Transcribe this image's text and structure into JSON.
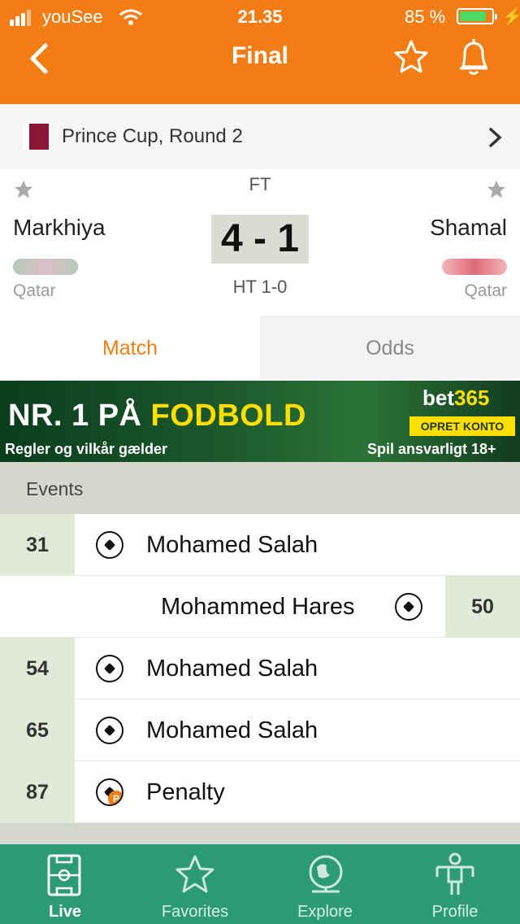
{
  "status_bar": {
    "carrier": "youSee",
    "time": "21.35",
    "battery": "85 %",
    "battery_level": 0.85
  },
  "header": {
    "title": "Final"
  },
  "competition": {
    "name": "Prince Cup, Round 2"
  },
  "match": {
    "status": "FT",
    "home_team": "Markhiya",
    "home_country": "Qatar",
    "away_team": "Shamal",
    "away_country": "Qatar",
    "score": "4 - 1",
    "halftime": "HT 1-0"
  },
  "tabs": [
    {
      "label": "Match"
    },
    {
      "label": "Odds"
    }
  ],
  "banner": {
    "headline_white": "NR. 1 PÅ ",
    "headline_yellow": "FODBOLD",
    "brand_white": "bet",
    "brand_yellow": "365",
    "cta": "OPRET KONTO",
    "terms": "Regler og vilkår gælder",
    "responsible": "Spil ansvarligt 18+"
  },
  "events": {
    "title": "Events",
    "items": [
      {
        "minute": "31",
        "player": "Mohamed Salah",
        "side": "home"
      },
      {
        "minute": "50",
        "player": "Mohammed Hares",
        "side": "away"
      },
      {
        "minute": "54",
        "player": "Mohamed Salah",
        "side": "home"
      },
      {
        "minute": "65",
        "player": "Mohamed Salah",
        "side": "home"
      },
      {
        "minute": "87",
        "player": "Penalty",
        "side": "home",
        "penalty_mark": "P"
      }
    ]
  },
  "tabbar": [
    {
      "label": "Live",
      "icon": "pitch-icon"
    },
    {
      "label": "Favorites",
      "icon": "star-icon"
    },
    {
      "label": "Explore",
      "icon": "globe-icon"
    },
    {
      "label": "Profile",
      "icon": "player-icon"
    }
  ]
}
